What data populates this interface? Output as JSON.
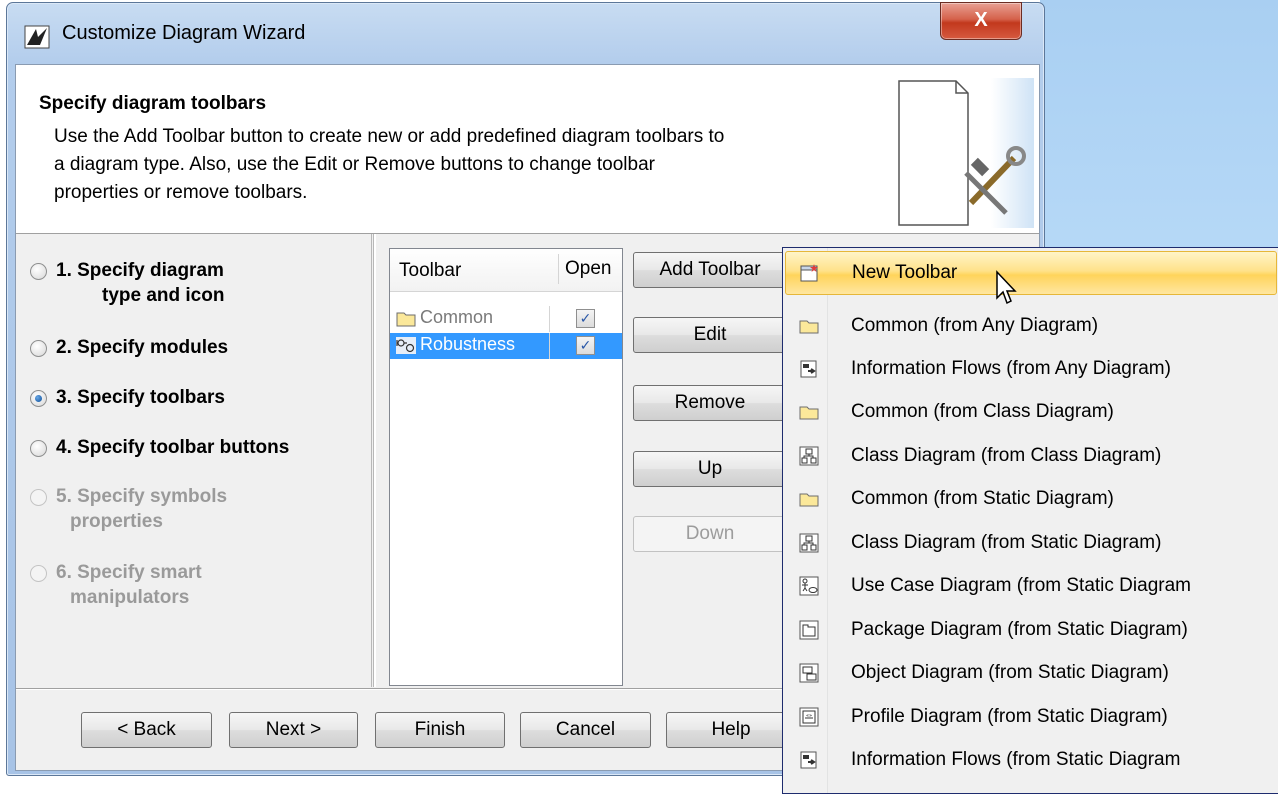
{
  "window": {
    "title": "Customize Diagram Wizard",
    "close_label": "X"
  },
  "header": {
    "title": "Specify diagram toolbars",
    "description_lines": [
      "Use the Add Toolbar button to create new or add predefined diagram toolbars to",
      "a diagram type. Also, use the Edit or Remove buttons to change toolbar",
      "properties or remove toolbars."
    ]
  },
  "steps": [
    {
      "line1": "1. Specify diagram",
      "line2": "type and icon",
      "selected": false,
      "enabled": true
    },
    {
      "line1": "2. Specify modules",
      "line2": "",
      "selected": false,
      "enabled": true
    },
    {
      "line1": "3. Specify toolbars",
      "line2": "",
      "selected": true,
      "enabled": true
    },
    {
      "line1": "4. Specify toolbar buttons",
      "line2": "",
      "selected": false,
      "enabled": true
    },
    {
      "line1": "5. Specify symbols",
      "line2": "properties",
      "selected": false,
      "enabled": false
    },
    {
      "line1": "6. Specify smart",
      "line2": "manipulators",
      "selected": false,
      "enabled": false
    }
  ],
  "table": {
    "columns": [
      "Toolbar",
      "Open"
    ],
    "rows": [
      {
        "name": "Common",
        "open": true,
        "selected": false,
        "icon": "folder-icon"
      },
      {
        "name": "Robustness",
        "open": true,
        "selected": true,
        "icon": "robustness-icon"
      }
    ],
    "check_mark": "✓"
  },
  "side_buttons": {
    "add_toolbar": "Add Toolbar",
    "edit": "Edit",
    "remove": "Remove",
    "up": "Up",
    "down": "Down"
  },
  "footer_buttons": {
    "back": "< Back",
    "next": "Next >",
    "finish": "Finish",
    "cancel": "Cancel",
    "help": "Help"
  },
  "menu": {
    "items": [
      {
        "label": "New Toolbar",
        "icon": "new-toolbar-icon",
        "highlighted": true
      },
      {
        "label": "Common (from Any Diagram)",
        "icon": "folder-icon"
      },
      {
        "label": "Information Flows (from Any Diagram)",
        "icon": "information-flow-icon"
      },
      {
        "label": "Common (from Class Diagram)",
        "icon": "folder-icon"
      },
      {
        "label": "Class Diagram (from Class Diagram)",
        "icon": "class-diagram-icon"
      },
      {
        "label": "Common (from Static Diagram)",
        "icon": "folder-icon"
      },
      {
        "label": "Class Diagram (from Static Diagram)",
        "icon": "class-diagram-icon"
      },
      {
        "label": "Use Case Diagram (from Static Diagram",
        "icon": "use-case-diagram-icon"
      },
      {
        "label": "Package Diagram (from Static Diagram)",
        "icon": "package-diagram-icon"
      },
      {
        "label": "Object Diagram (from Static Diagram)",
        "icon": "object-diagram-icon"
      },
      {
        "label": "Profile Diagram (from Static Diagram)",
        "icon": "profile-diagram-icon"
      },
      {
        "label": "Information Flows (from Static Diagram",
        "icon": "information-flow-icon"
      }
    ]
  },
  "colors": {
    "selection_blue": "#3399ff",
    "menu_highlight": "#ffd45b",
    "close_red": "#c2381d"
  }
}
